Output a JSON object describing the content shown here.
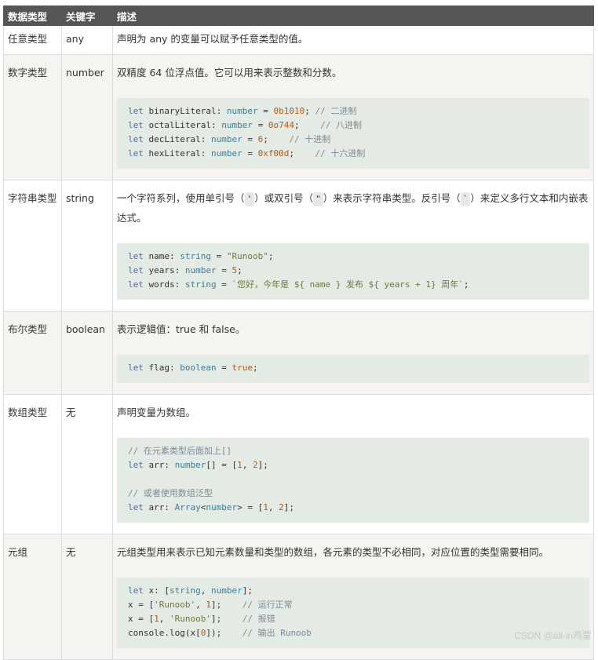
{
  "headers": [
    "数据类型",
    "关键字",
    "描述"
  ],
  "rows": [
    {
      "type": "任意类型",
      "keyword": "any",
      "desc": "声明为 any 的变量可以赋予任意类型的值。"
    },
    {
      "type": "数字类型",
      "keyword": "number",
      "desc": "双精度 64 位浮点值。它可以用来表示整数和分数。",
      "code": [
        "let binaryLiteral: number = 0b1010; // 二进制",
        "let octalLiteral: number = 0o744;    // 八进制",
        "let decLiteral: number = 6;    // 十进制",
        "let hexLiteral: number = 0xf00d;    // 十六进制"
      ]
    },
    {
      "type": "字符串类型",
      "keyword": "string",
      "desc_parts": [
        "一个字符系列，使用单引号（",
        "'",
        "）或双引号（",
        "\"",
        "）来表示字符串类型。反引号（",
        "`",
        "）来定义多行文本和内嵌表达式。"
      ],
      "code": [
        "let name: string = \"Runoob\";",
        "let years: number = 5;",
        "let words: string = `您好，今年是 ${ name } 发布 ${ years + 1} 周年`;"
      ]
    },
    {
      "type": "布尔类型",
      "keyword": "boolean",
      "desc": "表示逻辑值：true 和 false。",
      "code": [
        "let flag: boolean = true;"
      ]
    },
    {
      "type": "数组类型",
      "keyword": "无",
      "desc": "声明变量为数组。",
      "code": [
        "// 在元素类型后面加上[]",
        "let arr: number[] = [1, 2];",
        "",
        "// 或者使用数组泛型",
        "let arr: Array<number> = [1, 2];"
      ]
    },
    {
      "type": "元组",
      "keyword": "无",
      "desc": "元组类型用来表示已知元素数量和类型的数组，各元素的类型不必相同，对应位置的类型需要相同。",
      "code": [
        "let x: [string, number];",
        "x = ['Runoob', 1];    // 运行正常",
        "x = [1, 'Runoob'];    // 报错",
        "console.log(x[0]);    // 输出 Runoob"
      ]
    }
  ],
  "watermark": "CSDN @all-in鸡蒙"
}
